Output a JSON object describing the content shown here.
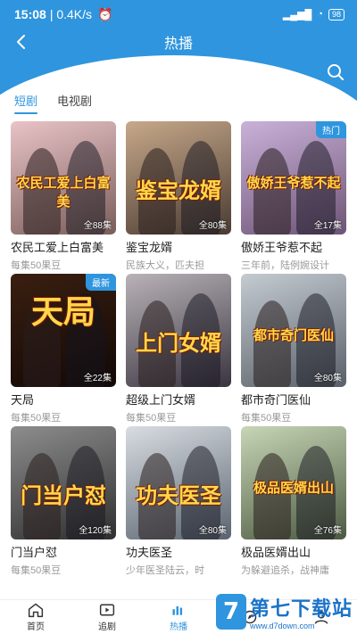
{
  "status_bar": {
    "time": "15:08",
    "speed": "| 0.4K/s",
    "signal": "4G",
    "battery": "98"
  },
  "header": {
    "title": "热播",
    "subtitle": "热播"
  },
  "tabs": [
    {
      "label": "短剧",
      "active": true
    },
    {
      "label": "电视剧",
      "active": false
    }
  ],
  "items": [
    {
      "name": "农民工爱上白富美",
      "desc": "每集50果豆",
      "episodes": "全88集",
      "badge": "",
      "poster_text": "农民工爱上白富美",
      "colors": [
        "#e9c3c7",
        "#7a5e5a"
      ]
    },
    {
      "name": "鉴宝龙婿",
      "desc": "民族大义，匹夫担",
      "episodes": "全80集",
      "badge": "",
      "poster_text": "鉴宝龙婿",
      "colors": [
        "#c7a98a",
        "#4a3b33"
      ]
    },
    {
      "name": "傲娇王爷惹不起",
      "desc": "三年前，陆例婉设计",
      "episodes": "全17集",
      "badge": "热门",
      "poster_text": "傲娇王爷惹不起",
      "colors": [
        "#c9b1d8",
        "#6e5577"
      ]
    },
    {
      "name": "天局",
      "desc": "每集50果豆",
      "episodes": "全22集",
      "badge": "最新",
      "poster_text": "天局",
      "colors": [
        "#3a1f10",
        "#120806"
      ]
    },
    {
      "name": "超级上门女婿",
      "desc": "每集50果豆",
      "episodes": "",
      "badge": "",
      "poster_text": "上门女婿",
      "colors": [
        "#b9b3b8",
        "#3a3440"
      ]
    },
    {
      "name": "都市奇门医仙",
      "desc": "每集50果豆",
      "episodes": "全80集",
      "badge": "",
      "poster_text": "都市奇门医仙",
      "colors": [
        "#c4cbd1",
        "#596069"
      ]
    },
    {
      "name": "门当户怼",
      "desc": "每集50果豆",
      "episodes": "全120集",
      "badge": "",
      "poster_text": "门当户怼",
      "colors": [
        "#8d8d8d",
        "#2f2f2f"
      ]
    },
    {
      "name": "功夫医圣",
      "desc": "少年医圣陆云，时",
      "episodes": "全80集",
      "badge": "",
      "poster_text": "功夫医圣",
      "colors": [
        "#d9dde2",
        "#5a6470"
      ]
    },
    {
      "name": "极品医婿出山",
      "desc": "为躲避追杀，战神庸",
      "episodes": "全76集",
      "badge": "",
      "poster_text": "极品医婿出山",
      "colors": [
        "#c7d6b6",
        "#4d5a42"
      ]
    }
  ],
  "bottom_nav": [
    {
      "label": "首页",
      "icon": "home-icon",
      "active": false
    },
    {
      "label": "追剧",
      "icon": "play-icon",
      "active": false
    },
    {
      "label": "热播",
      "icon": "fire-icon",
      "active": true
    },
    {
      "label": "",
      "icon": "discover-icon",
      "active": false
    },
    {
      "label": "",
      "icon": "user-icon",
      "active": false
    }
  ],
  "watermark": {
    "logo": "7",
    "title": "第七下载站",
    "url": "www.d7down.com"
  },
  "colors": {
    "accent": "#2f95de"
  }
}
